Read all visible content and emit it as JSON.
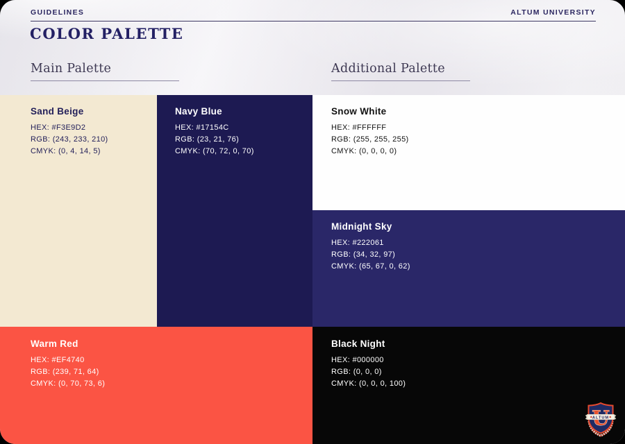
{
  "header": {
    "left_label": "GUIDELINES",
    "right_label": "ALTUM UNIVERSITY",
    "title": "COLOR PALETTE"
  },
  "sections": {
    "main_label": "Main Palette",
    "additional_label": "Additional Palette"
  },
  "swatches": [
    {
      "name": "Sand Beige",
      "hex": "HEX: #F3E9D2",
      "rgb": "RGB: (243, 233, 210)",
      "cmyk": "CMYK: (0, 4, 14, 5)",
      "display": "#f3e9d2",
      "text": "#23205a"
    },
    {
      "name": "Navy Blue",
      "hex": "HEX: #17154C",
      "rgb": "RGB: (23, 21, 76)",
      "cmyk": "CMYK: (70, 72, 0, 70)",
      "display": "#1d1a52",
      "text": "#ffffff"
    },
    {
      "name": "Snow White",
      "hex": "HEX: #FFFFFF",
      "rgb": "RGB: (255, 255, 255)",
      "cmyk": "CMYK: (0, 0, 0, 0)",
      "display": "#fefefe",
      "text": "#121212"
    },
    {
      "name": "Midnight Sky",
      "hex": "HEX: #222061",
      "rgb": "RGB: (34, 32, 97)",
      "cmyk": "CMYK: (65, 67, 0, 62)",
      "display": "#2a2768",
      "text": "#ffffff"
    },
    {
      "name": "Warm Red",
      "hex": "HEX: #EF4740",
      "rgb": "RGB: (239, 71, 64)",
      "cmyk": "CMYK: (0, 70, 73, 6)",
      "display": "#fb5444",
      "text": "#ffffff"
    },
    {
      "name": "Black Night",
      "hex": "HEX: #000000",
      "rgb": "RGB: (0, 0, 0)",
      "cmyk": "CMYK: (0, 0, 0, 100)",
      "display": "#070707",
      "text": "#ffffff"
    }
  ],
  "logo": {
    "banner_text": "ALTUM",
    "letter": "U"
  }
}
